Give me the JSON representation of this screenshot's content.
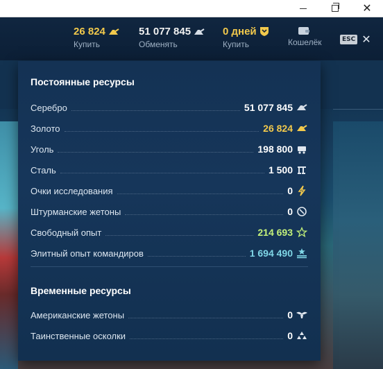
{
  "topbar": {
    "silver_gold": {
      "value": "26 824",
      "label": "Купить"
    },
    "credits": {
      "value": "51 077 845",
      "label": "Обменять"
    },
    "premium": {
      "value": "0 дней",
      "label": "Купить"
    },
    "wallet": {
      "label": "Кошелёк"
    },
    "esc_label": "ESC"
  },
  "panel": {
    "permanent_title": "Постоянные ресурсы",
    "permanent": [
      {
        "name": "Серебро",
        "value": "51 077 845"
      },
      {
        "name": "Золото",
        "value": "26 824"
      },
      {
        "name": "Уголь",
        "value": "198 800"
      },
      {
        "name": "Сталь",
        "value": "1 500"
      },
      {
        "name": "Очки исследования",
        "value": "0"
      },
      {
        "name": "Штурманские жетоны",
        "value": "0"
      },
      {
        "name": "Свободный опыт",
        "value": "214 693"
      },
      {
        "name": "Элитный опыт командиров",
        "value": "1 694 490"
      }
    ],
    "temporary_title": "Временные ресурсы",
    "temporary": [
      {
        "name": "Американские жетоны",
        "value": "0"
      },
      {
        "name": "Таинственные осколки",
        "value": "0"
      }
    ]
  },
  "colors": {
    "gold": "#f2c94c",
    "free_xp": "#c3f07a",
    "elite_xp": "#7fd6e6",
    "panel_bg": "#143254"
  }
}
